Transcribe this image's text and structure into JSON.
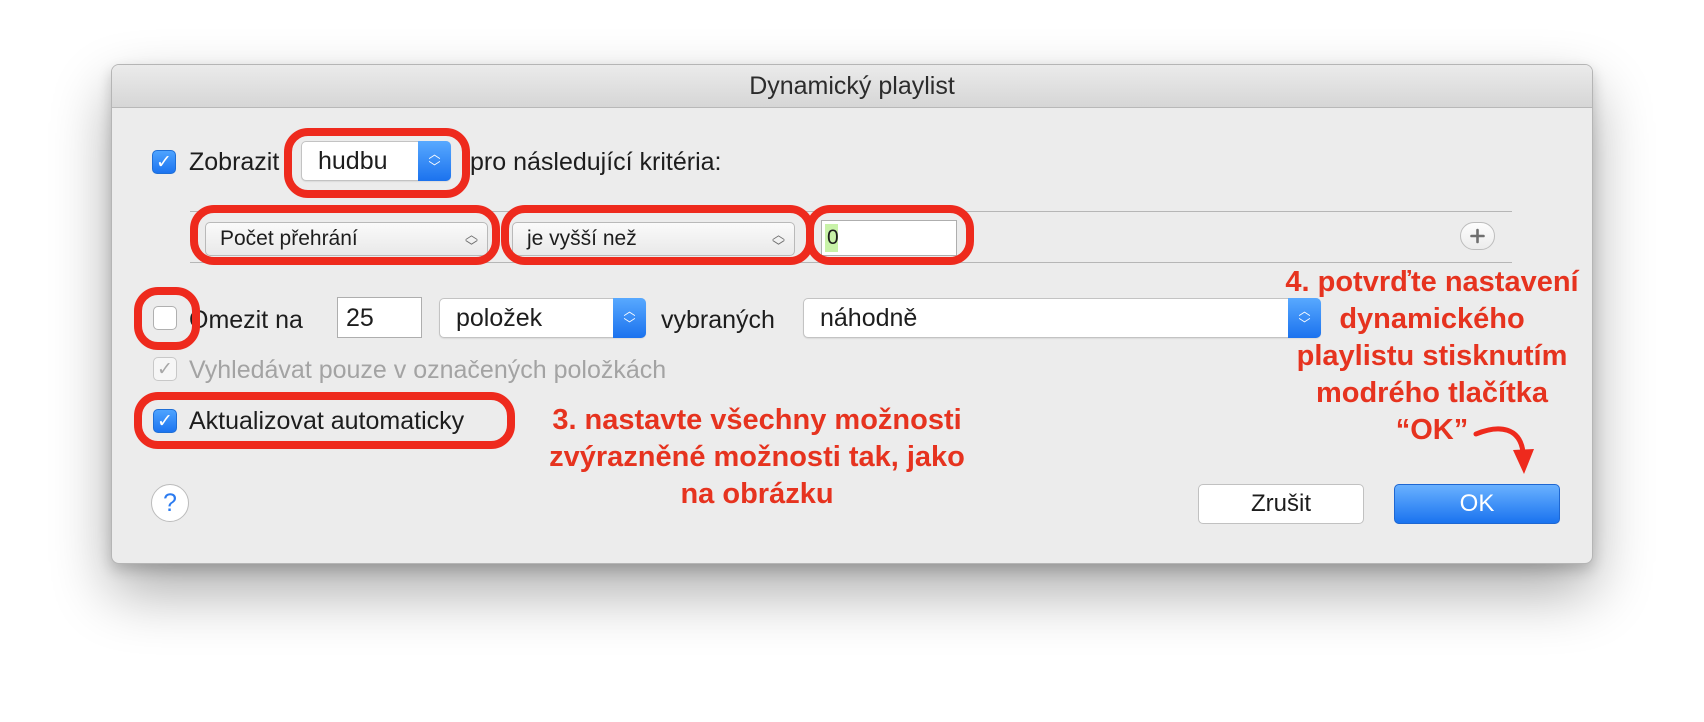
{
  "window": {
    "title": "Dynamický playlist"
  },
  "match": {
    "checkbox_label": "Zobrazit",
    "media_value": "hudbu",
    "suffix": "pro následující kritéria:"
  },
  "rule": {
    "field_value": "Počet přehrání",
    "operator_value": "je vyšší než",
    "value": "0",
    "add_icon": "plus-icon"
  },
  "limit": {
    "checkbox_label": "Omezit na",
    "count": "25",
    "unit_value": "položek",
    "middle_label": "vybraných",
    "order_value": "náhodně"
  },
  "checked_only": {
    "label": "Vyhledávat pouze v označených položkách"
  },
  "live_update": {
    "label": "Aktualizovat automaticky"
  },
  "buttons": {
    "help": "?",
    "cancel": "Zrušit",
    "ok": "OK"
  },
  "annotations": {
    "step3": [
      "3. nastavte všechny možnosti",
      "zvýrazněné možnosti tak, jako",
      "na obrázku"
    ],
    "step4": [
      "4. potvrďte nastavení",
      "dynamického",
      "playlistu stisknutím",
      "modrého tlačítka",
      "“OK”"
    ]
  },
  "colors": {
    "accent_blue": "#1c74f0",
    "annotation_red": "#ee2a1d",
    "window_bg": "#ececec"
  }
}
